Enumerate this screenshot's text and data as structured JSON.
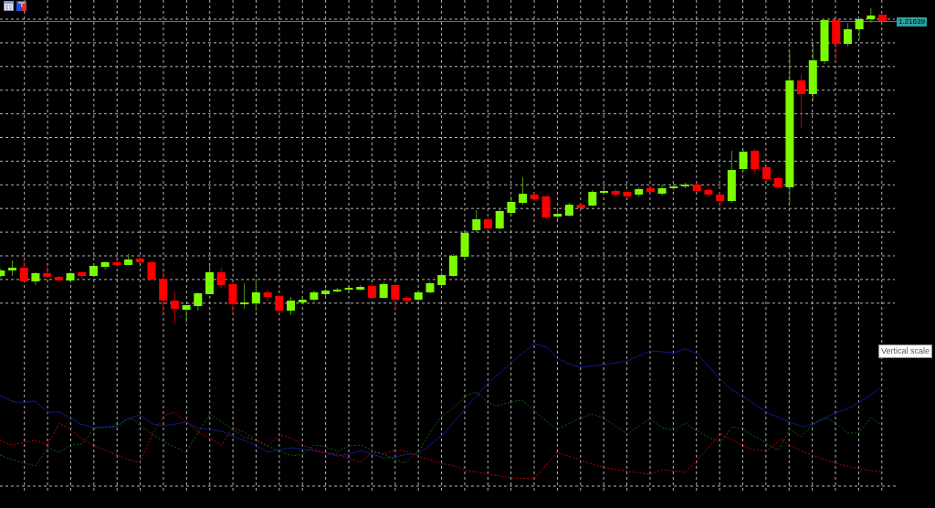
{
  "chart": {
    "price_label": "1.21639"
  },
  "indicator_window": {
    "tooltip": "Vertical scale"
  }
}
